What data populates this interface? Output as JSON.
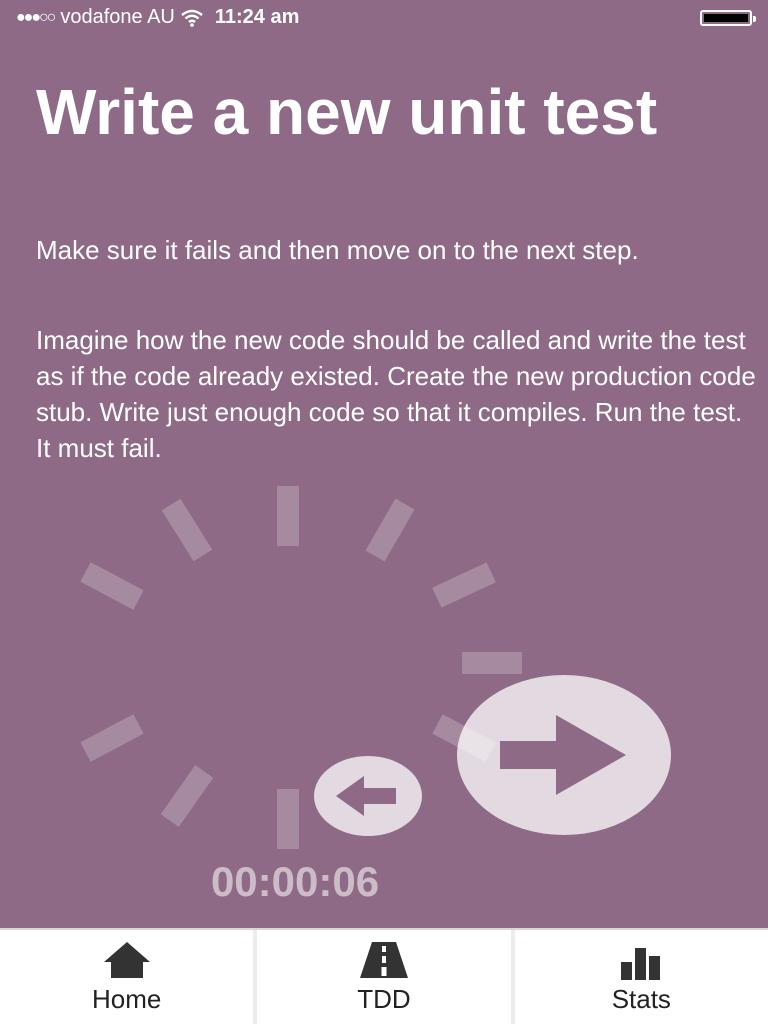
{
  "status_bar": {
    "signal": "●●●○○",
    "carrier": "vodafone AU",
    "time": "11:24 am"
  },
  "step": {
    "title": "Write a new unit test",
    "subtitle": "Make sure it fails and then move on to the next step.",
    "description": "Imagine how the new code should be called and write the test as if the code already existed. Create the new production code stub. Write just enough code so that it compiles. Run the test. It must fail."
  },
  "timer": {
    "elapsed": "00:00:06"
  },
  "controls": {
    "previous_icon": "arrow-left-icon",
    "next_icon": "arrow-right-icon"
  },
  "tab_bar": {
    "tabs": [
      {
        "label": "Home",
        "icon": "home-icon"
      },
      {
        "label": "TDD",
        "icon": "road-icon"
      },
      {
        "label": "Stats",
        "icon": "bar-chart-icon"
      }
    ]
  },
  "colors": {
    "background": "#8e6a86",
    "text": "#ffffff",
    "tab_bar": "#ffffff"
  }
}
